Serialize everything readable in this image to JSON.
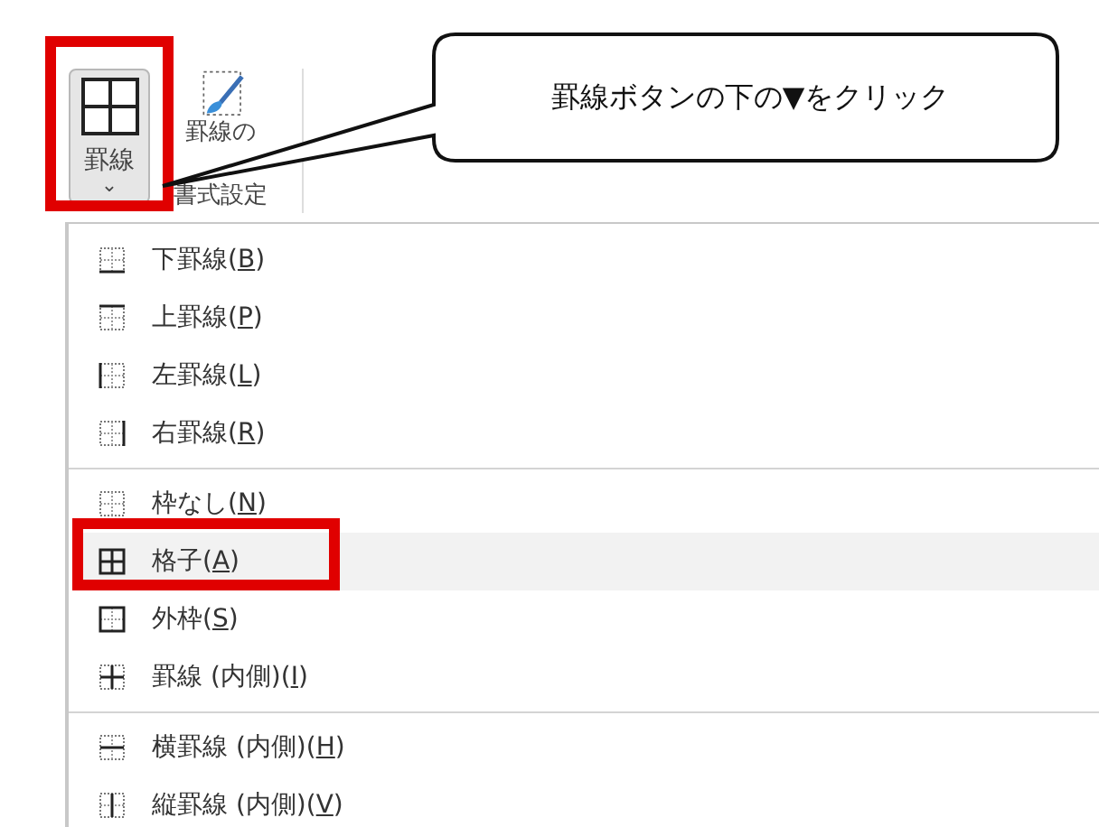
{
  "ribbon": {
    "buttons": [
      {
        "kind": "borders",
        "label": "罫線",
        "caret": "⌄"
      },
      {
        "kind": "format",
        "label_lines": [
          "罫線の",
          "書式設定"
        ]
      }
    ]
  },
  "callout": {
    "text": "罫線ボタンの下の▼をクリック"
  },
  "menu": {
    "groups": [
      [
        {
          "kind": "bottom",
          "before": "下罫線(",
          "key": "B",
          "after": ")",
          "selected": false
        },
        {
          "kind": "top",
          "before": "上罫線(",
          "key": "P",
          "after": ")",
          "selected": false
        },
        {
          "kind": "left",
          "before": "左罫線(",
          "key": "L",
          "after": ")",
          "selected": false
        },
        {
          "kind": "right",
          "before": "右罫線(",
          "key": "R",
          "after": ")",
          "selected": false
        }
      ],
      [
        {
          "kind": "none",
          "before": "枠なし(",
          "key": "N",
          "after": ")",
          "selected": false
        },
        {
          "kind": "all",
          "before": "格子(",
          "key": "A",
          "after": ")",
          "selected": true
        },
        {
          "kind": "outside",
          "before": "外枠(",
          "key": "S",
          "after": ")",
          "selected": false
        },
        {
          "kind": "inside",
          "before": "罫線 (内側)(",
          "key": "I",
          "after": ")",
          "selected": false
        }
      ],
      [
        {
          "kind": "inside_h",
          "before": "横罫線 (内側)(",
          "key": "H",
          "after": ")",
          "selected": false
        },
        {
          "kind": "inside_v",
          "before": "縦罫線 (内側)(",
          "key": "V",
          "after": ")",
          "selected": false
        }
      ]
    ]
  }
}
